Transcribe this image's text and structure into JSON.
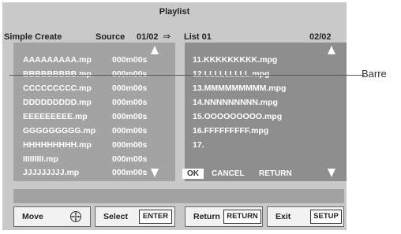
{
  "title": "Playlist",
  "header": {
    "mode": "Simple Create",
    "source_label": "Source",
    "source_page": "01/02",
    "arrow": "⇒",
    "target_list": "List 01",
    "target_page": "02/02"
  },
  "source_items": [
    {
      "name": "AAAAAAAAA.mp",
      "duration": "000m00s"
    },
    {
      "name": "BBBBBBBBB.mp",
      "duration": "000m00s"
    },
    {
      "name": "CCCCCCCCC.mp",
      "duration": "000m00s"
    },
    {
      "name": "DDDDDDDDD.mp",
      "duration": "000m00s"
    },
    {
      "name": "EEEEEEEEE.mp",
      "duration": "000m00s"
    },
    {
      "name": "GGGGGGGGG.mp",
      "duration": "000m00s"
    },
    {
      "name": "HHHHHHHHH.mp",
      "duration": "000m00s"
    },
    {
      "name": "IIIIIIIII.mp",
      "duration": "000m00s"
    },
    {
      "name": "JJJJJJJJJ.mp",
      "duration": "000m00s"
    }
  ],
  "list_items": [
    "11.KKKKKKKKK.mpg",
    "12.LLLLLLLLL.mpg",
    "13.MMMMMMMMM.mpg",
    "14.NNNNNNNNN.mpg",
    "15.OOOOOOOOO.mpg",
    "16.FFFFFFFFF.mpg",
    "17."
  ],
  "actions": {
    "ok": "OK",
    "cancel": "CANCEL",
    "return": "RETURN"
  },
  "buttons": {
    "move_label": "Move",
    "move_icon": "dpad-icon",
    "select_label": "Select",
    "select_key": "ENTER",
    "return_label": "Return",
    "return_key": "RETURN",
    "exit_label": "Exit",
    "exit_key": "SETUP"
  },
  "annotation": "Barre",
  "colors": {
    "panel_left": "#a3a3a3",
    "panel_right": "#8e8e8e",
    "screen_bg": "#c9c9c9"
  }
}
